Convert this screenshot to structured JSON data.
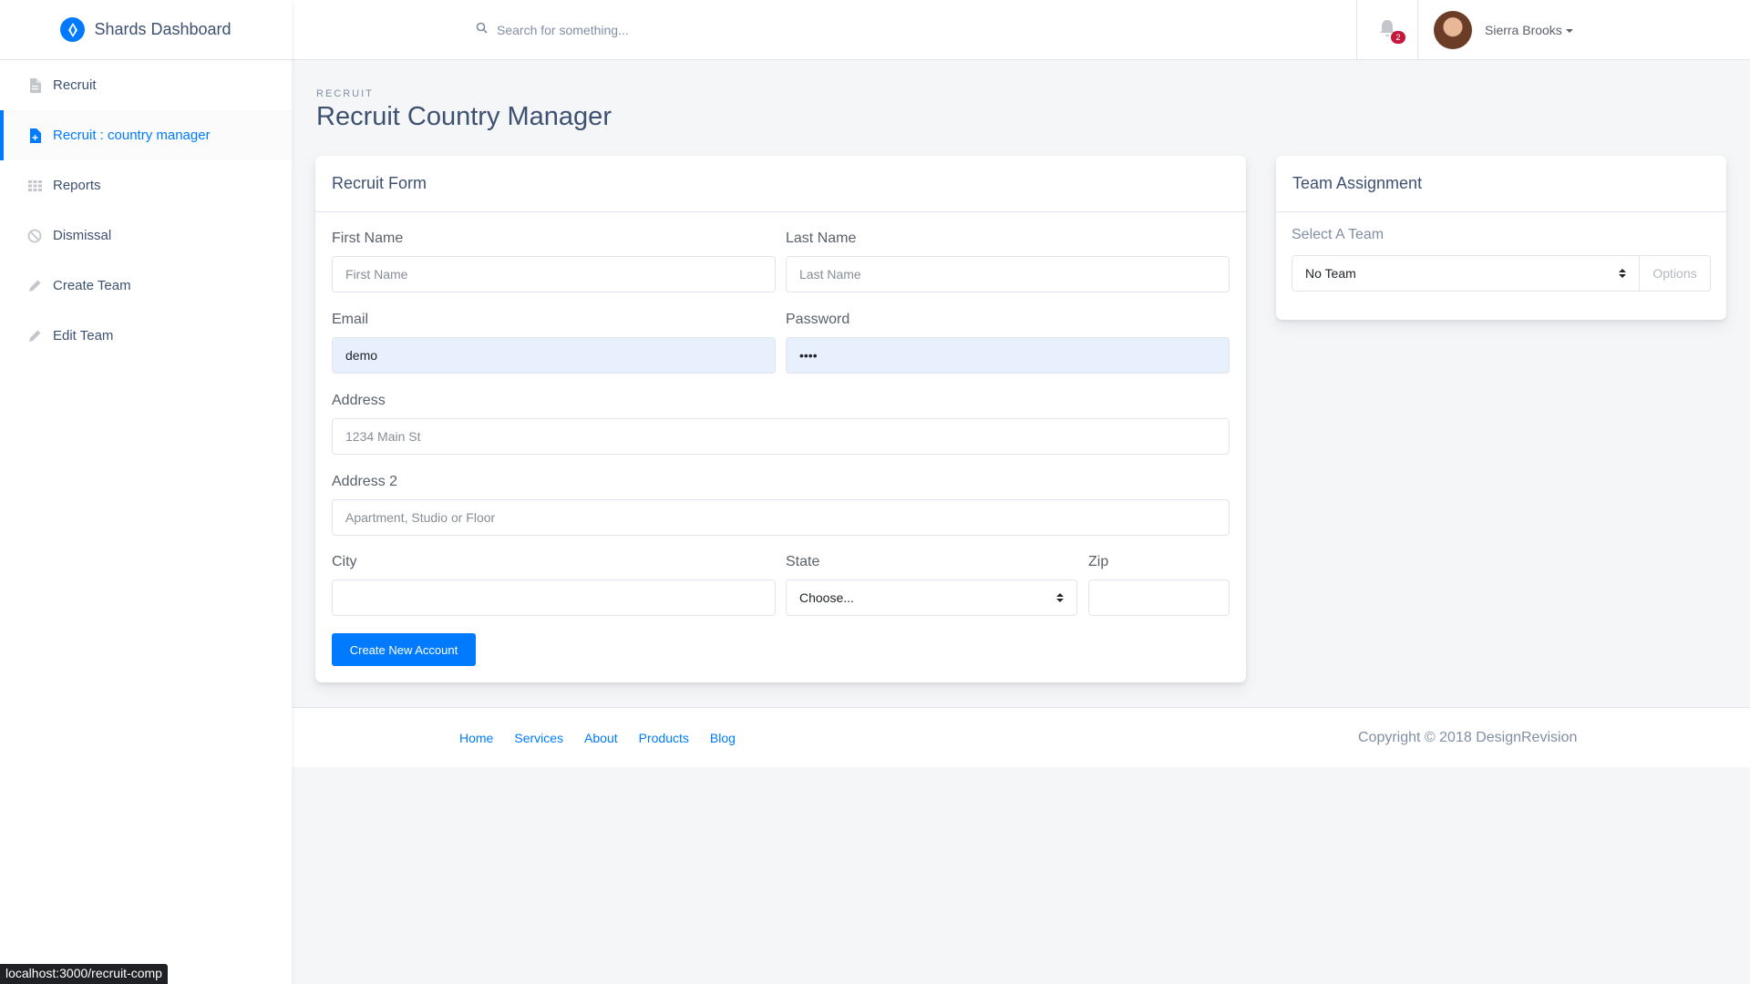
{
  "brand": {
    "name": "Shards Dashboard",
    "accent": "#007bff"
  },
  "sidebar": {
    "items": [
      {
        "label": "Recruit",
        "icon": "file-icon"
      },
      {
        "label": "Recruit : country manager",
        "icon": "file-add-icon",
        "active": true
      },
      {
        "label": "Reports",
        "icon": "grid-icon"
      },
      {
        "label": "Dismissal",
        "icon": "block-icon"
      },
      {
        "label": "Create Team",
        "icon": "pencil-icon"
      },
      {
        "label": "Edit Team",
        "icon": "pencil-icon"
      }
    ]
  },
  "topbar": {
    "search_placeholder": "Search for something...",
    "notification_count": "2",
    "user_name": "Sierra Brooks"
  },
  "page": {
    "subtitle": "RECRUIT",
    "title": "Recruit Country Manager"
  },
  "form": {
    "title": "Recruit Form",
    "first_name_label": "First Name",
    "first_name_placeholder": "First Name",
    "last_name_label": "Last Name",
    "last_name_placeholder": "Last Name",
    "email_label": "Email",
    "email_value": "demo",
    "password_label": "Password",
    "password_value": "demo",
    "address_label": "Address",
    "address_placeholder": "1234 Main St",
    "address2_label": "Address 2",
    "address2_placeholder": "Apartment, Studio or Floor",
    "city_label": "City",
    "state_label": "State",
    "state_value": "Choose...",
    "zip_label": "Zip",
    "submit_label": "Create New Account"
  },
  "team": {
    "title": "Team Assignment",
    "select_label": "Select A Team",
    "select_value": "No Team",
    "options_label": "Options"
  },
  "footer": {
    "links": [
      "Home",
      "Services",
      "About",
      "Products",
      "Blog"
    ],
    "copyright": "Copyright © 2018 DesignRevision"
  },
  "statusbar": {
    "url": "localhost:3000/recruit-comp"
  }
}
